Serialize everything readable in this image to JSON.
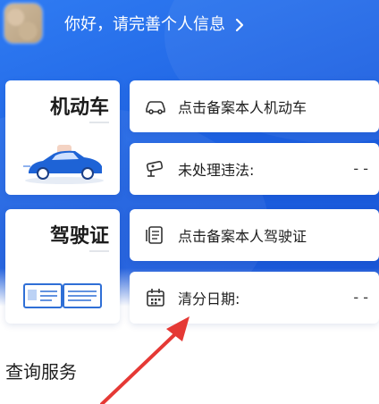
{
  "header": {
    "greeting": "你好，请完善个人信息"
  },
  "vehicle": {
    "title": "机动车",
    "register_label": "点击备案本人机动车",
    "violations_label": "未处理违法:",
    "violations_value": "- -"
  },
  "license": {
    "title": "驾驶证",
    "register_label": "点击备案本人驾驶证",
    "clear_date_label": "清分日期:",
    "clear_date_value": "- -"
  },
  "services": {
    "title": "查询服务"
  },
  "colors": {
    "primary": "#1c5fe0",
    "annotation_arrow": "#e53935"
  },
  "icons": [
    "car-icon",
    "camera-icon",
    "document-icon",
    "calendar-icon",
    "chevron-right-icon",
    "car-illustration",
    "license-illustration"
  ]
}
